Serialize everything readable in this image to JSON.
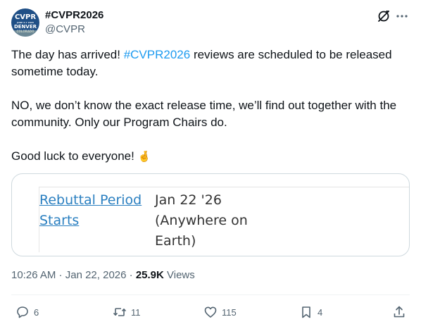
{
  "author": {
    "display_name": "#CVPR2026",
    "handle": "@CVPR",
    "avatar": {
      "line1": "CVPR",
      "line2": "JUNE 3-7 2026",
      "line3": "DENVER",
      "line4": "COLORADO",
      "color": "#1f4f86"
    }
  },
  "tweet": {
    "p1_before": "The day has arrived! ",
    "p1_hashtag": "#CVPR2026",
    "p1_after": " reviews are scheduled to be released sometime today.",
    "p2": "NO, we don’t know the exact release time, we’ll find out together with the community. Only our Program Chairs do.",
    "p3": "Good luck to everyone! ",
    "p3_emoji": "🤞",
    "hashtag_color": "#1d9bf0"
  },
  "card": {
    "label": "Rebuttal Period Starts",
    "value": "Jan 22 '26 (Anywhere on Earth)"
  },
  "meta": {
    "time": "10:26 AM",
    "sep1": " · ",
    "date": "Jan 22, 2026",
    "sep2": " · ",
    "views_count": "25.9K",
    "views_label": " Views"
  },
  "actions": {
    "replies": "6",
    "reposts": "11",
    "likes": "115",
    "bookmarks": "4"
  },
  "icons": [
    "grok-icon",
    "more-icon",
    "reply-icon",
    "repost-icon",
    "like-icon",
    "bookmark-icon",
    "share-icon"
  ]
}
